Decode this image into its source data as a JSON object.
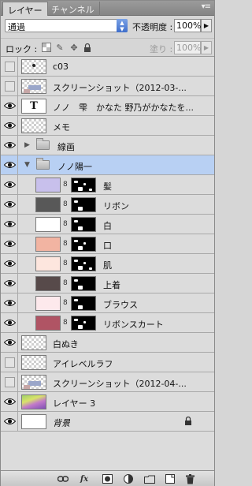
{
  "tabs": [
    {
      "label": "レイヤー",
      "active": true
    },
    {
      "label": "チャンネル",
      "active": false
    }
  ],
  "blend": {
    "mode": "通過",
    "opacity_label": "不透明度 :",
    "opacity_value": "100%"
  },
  "lock": {
    "label": "ロック :",
    "fill_label": "塗り :",
    "fill_value": "100%"
  },
  "layers": [
    {
      "name": "c03",
      "visible": false,
      "thumb": "checker-dot"
    },
    {
      "name": "スクリーンショット（2012-03-...",
      "visible": false,
      "thumb": "checker-screenshot"
    },
    {
      "name": "ノノ　雫　かなた 野乃がかなたを...",
      "visible": true,
      "thumb": "text",
      "thumb_text": "T"
    },
    {
      "name": "メモ",
      "visible": true,
      "thumb": "checker"
    },
    {
      "name": "線画",
      "visible": true,
      "thumb": "folder",
      "expanded": false
    },
    {
      "name": "ノノ陽一",
      "visible": true,
      "thumb": "folder",
      "expanded": true,
      "selected": true
    },
    {
      "name": "髪",
      "visible": true,
      "color": "#c8c0ec",
      "indent": true,
      "masked": true
    },
    {
      "name": "リボン",
      "visible": true,
      "color": "#585858",
      "indent": true,
      "masked": true
    },
    {
      "name": "白",
      "visible": true,
      "color": "#ffffff",
      "indent": true,
      "masked": true
    },
    {
      "name": "口",
      "visible": true,
      "color": "#f2b4a2",
      "indent": true,
      "masked": true
    },
    {
      "name": "肌",
      "visible": true,
      "color": "#fde6de",
      "indent": true,
      "masked": true
    },
    {
      "name": "上着",
      "visible": true,
      "color": "#574a4a",
      "indent": true,
      "masked": true
    },
    {
      "name": "ブラウス",
      "visible": true,
      "color": "#fde9ec",
      "indent": true,
      "masked": true
    },
    {
      "name": "リボンスカート",
      "visible": true,
      "color": "#b05464",
      "indent": true,
      "masked": true
    },
    {
      "name": "白ぬき",
      "visible": true,
      "thumb": "checker"
    },
    {
      "name": "アイレベルラフ",
      "visible": false,
      "thumb": "checker"
    },
    {
      "name": "スクリーンショット（2012-04-...",
      "visible": false,
      "thumb": "checker-screenshot"
    },
    {
      "name": "レイヤー 3",
      "visible": true,
      "thumb": "image"
    },
    {
      "name": "背景",
      "visible": true,
      "thumb": "white",
      "italic": true,
      "locked": true
    }
  ],
  "bottom_icons": [
    "link-icon",
    "fx-icon",
    "mask-icon",
    "adjustment-icon",
    "folder-icon",
    "new-layer-icon",
    "trash-icon"
  ]
}
